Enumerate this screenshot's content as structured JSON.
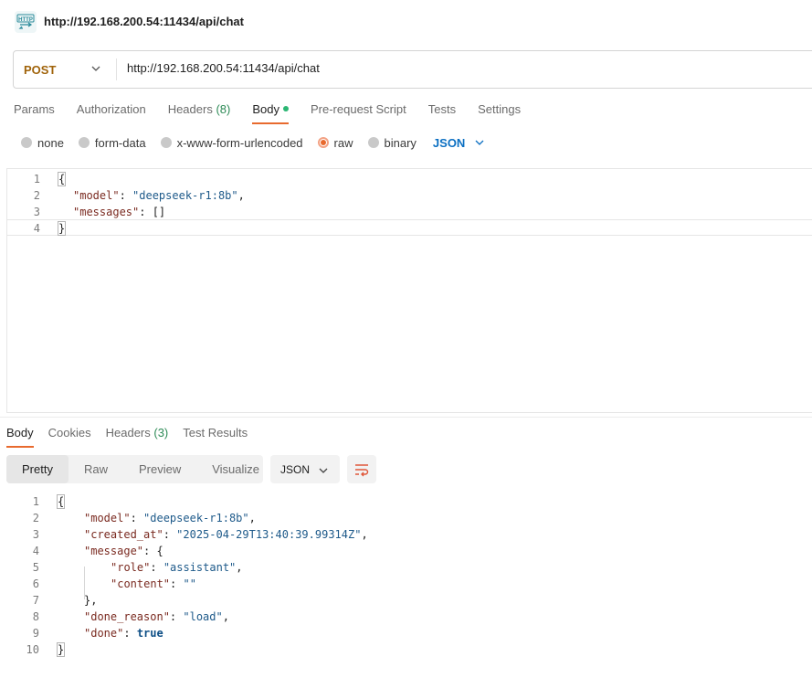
{
  "window": {
    "title": "http://192.168.200.54:11434/api/chat",
    "icon": "http-icon"
  },
  "request": {
    "method": "POST",
    "url": "http://192.168.200.54:11434/api/chat",
    "tabs": [
      {
        "label": "Params"
      },
      {
        "label": "Authorization"
      },
      {
        "label": "Headers",
        "count": "(8)"
      },
      {
        "label": "Body",
        "active": true
      },
      {
        "label": "Pre-request Script"
      },
      {
        "label": "Tests"
      },
      {
        "label": "Settings"
      }
    ],
    "body_types": [
      "none",
      "form-data",
      "x-www-form-urlencoded",
      "raw",
      "binary"
    ],
    "selected_body_type": "raw",
    "format": "JSON",
    "code_lines": [
      "1",
      "2",
      "3",
      "4"
    ]
  },
  "response": {
    "tabs": [
      {
        "label": "Body",
        "active": true
      },
      {
        "label": "Cookies"
      },
      {
        "label": "Headers",
        "count": "(3)"
      },
      {
        "label": "Test Results"
      }
    ],
    "views": [
      "Pretty",
      "Raw",
      "Preview",
      "Visualize"
    ],
    "active_view": "Pretty",
    "format": "JSON",
    "code_lines": [
      "1",
      "2",
      "3",
      "4",
      "5",
      "6",
      "7",
      "8",
      "9",
      "10"
    ]
  },
  "colors": {
    "accent": "#e86a2e",
    "method": "#a0630a",
    "link": "#0b6fc2",
    "count": "#2e8b57",
    "active_dot": "#2bb673"
  }
}
